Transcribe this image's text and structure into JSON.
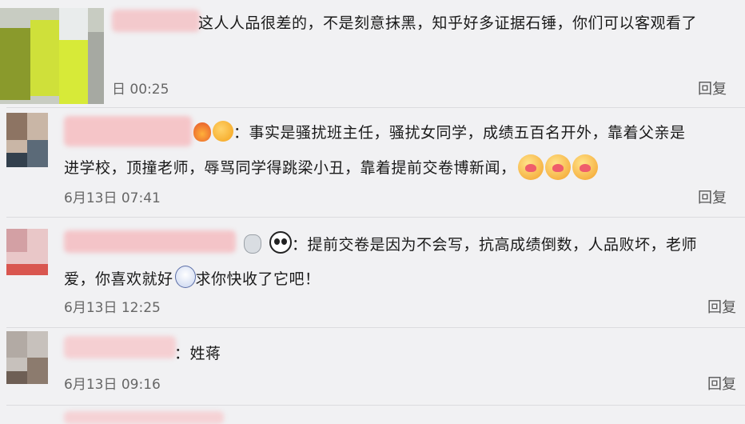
{
  "comments": [
    {
      "text_lines": [
        "这人人品很差的，不是刻意抹黑，知乎好多证据石锤，你们可以客观看了"
      ],
      "time": "日 00:25",
      "reply": "回复"
    },
    {
      "text_lines": [
        "：事实是骚扰班主任，骚扰女同学，成绩五百名开外，靠着父亲是",
        "进学校，顶撞老师，辱骂同学得跳梁小丑，靠着提前交卷博新闻，"
      ],
      "emoji": [
        "fire-emoji",
        "smile-emoji",
        "kiss-emoji",
        "kiss-emoji",
        "kiss-emoji"
      ],
      "time": "6月13日 07:41",
      "reply": "回复"
    },
    {
      "text_lines": [
        "：提前交卷是因为不会写，抗高成绩倒数，人品败坏，老师",
        "爱，你喜欢就好",
        "求你快收了它吧！"
      ],
      "emoji": [
        "money-bag-emoji",
        "panda-emoji",
        "ghost-emoji"
      ],
      "time": "6月13日 12:25",
      "reply": "回复"
    },
    {
      "text_lines": [
        "：姓蒋"
      ],
      "time": "6月13日 09:16",
      "reply": "回复"
    }
  ],
  "colors": {
    "background": "#f1f1f3",
    "divider": "#dcdcdf",
    "time": "#666666",
    "reply": "#555555"
  }
}
